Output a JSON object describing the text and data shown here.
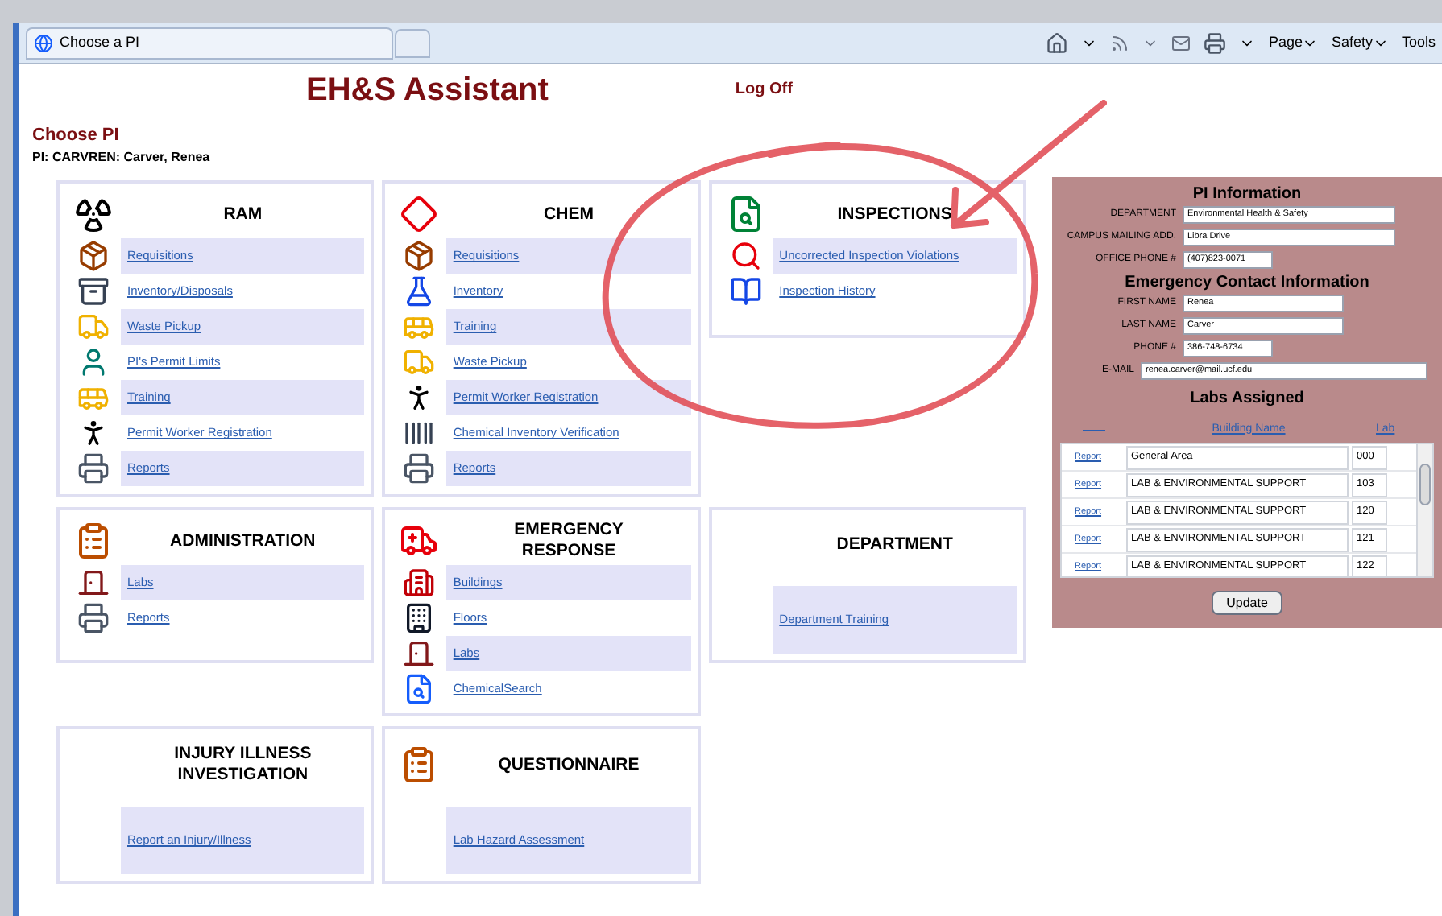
{
  "browser": {
    "tab_title": "Choose a PI",
    "menus": [
      {
        "label": "Page",
        "dropdown": true
      },
      {
        "label": "Safety",
        "dropdown": true
      },
      {
        "label": "Tools",
        "dropdown": false
      }
    ]
  },
  "header": {
    "title": "EH&S Assistant",
    "log_off": "Log Off"
  },
  "heading": "Choose PI",
  "pi_line": "PI: CARVREN: Carver, Renea",
  "panels": [
    {
      "title": "RAM",
      "items": [
        "Requisitions",
        "Inventory/Disposals",
        "Waste Pickup",
        "PI's Permit Limits",
        "Training",
        "Permit Worker Registration",
        "Reports"
      ]
    },
    {
      "title": "CHEM",
      "items": [
        "Requisitions",
        "Inventory",
        "Training",
        "Waste Pickup",
        "Permit Worker Registration",
        "Chemical Inventory Verification",
        "Reports"
      ]
    },
    {
      "title": "INSPECTIONS",
      "items": [
        "Uncorrected Inspection Violations",
        "Inspection History"
      ]
    },
    {
      "title": "ADMINISTRATION",
      "items": [
        "Labs",
        "Reports"
      ]
    },
    {
      "title": "EMERGENCY RESPONSE",
      "items": [
        "Buildings",
        "Floors",
        "Labs",
        "ChemicalSearch"
      ]
    },
    {
      "title": "DEPARTMENT",
      "items": [
        "Department Training"
      ]
    },
    {
      "title": "INJURY ILLNESS INVESTIGATION",
      "items": [
        "Report an Injury/Illness"
      ]
    },
    {
      "title": "QUESTIONNAIRE",
      "items": [
        "Lab Hazard Assessment"
      ]
    }
  ],
  "pi_info": {
    "title": "PI Information",
    "fields": [
      {
        "label": "DEPARTMENT",
        "value": "Environmental Health & Safety"
      },
      {
        "label": "CAMPUS MAILING ADD.",
        "value": "Libra Drive"
      },
      {
        "label": "OFFICE PHONE #",
        "value": "(407)823-0071"
      }
    ],
    "emergency_title": "Emergency Contact Information",
    "emergency_fields": [
      {
        "label": "FIRST NAME",
        "value": "Renea"
      },
      {
        "label": "LAST NAME",
        "value": "Carver"
      },
      {
        "label": "PHONE #",
        "value": "386-748-6734"
      },
      {
        "label": "E-MAIL",
        "value": "renea.carver@mail.ucf.edu"
      }
    ],
    "labs_title": "Labs Assigned",
    "columns": [
      "Building Name",
      "Lab"
    ],
    "rows": [
      {
        "link": "Report",
        "building": "General Area",
        "lab": "000"
      },
      {
        "link": "Report",
        "building": "LAB & ENVIRONMENTAL SUPPORT",
        "lab": "103"
      },
      {
        "link": "Report",
        "building": "LAB & ENVIRONMENTAL SUPPORT",
        "lab": "120"
      },
      {
        "link": "Report",
        "building": "LAB & ENVIRONMENTAL SUPPORT",
        "lab": "121"
      },
      {
        "link": "Report",
        "building": "LAB & ENVIRONMENTAL SUPPORT",
        "lab": "122"
      }
    ],
    "button": "Update"
  }
}
